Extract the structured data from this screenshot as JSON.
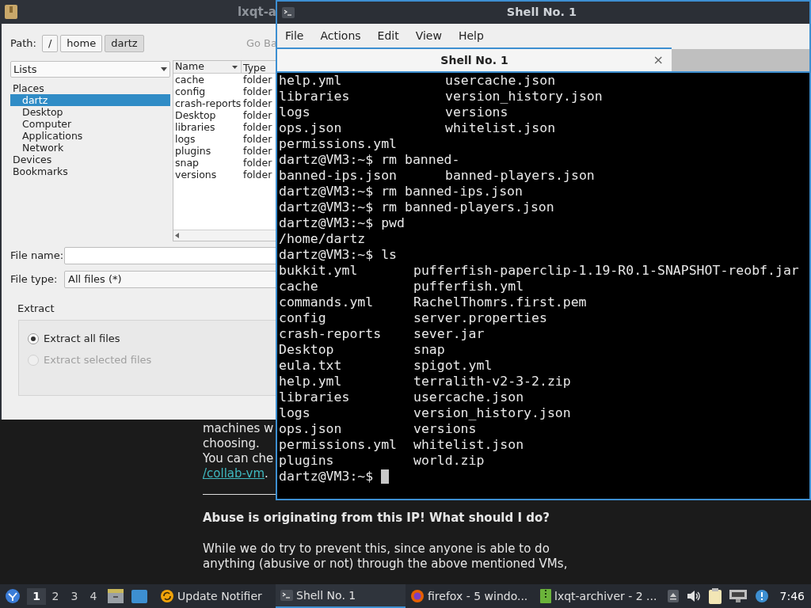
{
  "web_page": {
    "lines": [
      "machines w",
      "choosing.",
      "You can che"
    ],
    "link": "/collab-vm",
    "link_after": ".",
    "heading": "Abuse is originating from this IP! What should I do?",
    "paragraph": "While we do try to prevent this, since anyone is able to do anything (abusive or not) through the above mentioned VMs,"
  },
  "archiver": {
    "title": "lxqt-a",
    "path_label": "Path:",
    "path_buttons": [
      {
        "label": "/",
        "selected": false
      },
      {
        "label": "home",
        "selected": false
      },
      {
        "label": "dartz",
        "selected": true
      }
    ],
    "go_back": "Go Ba",
    "view_combo": "Lists",
    "places": [
      {
        "label": "Places",
        "selected": false,
        "children": [
          {
            "label": "dartz",
            "selected": true
          },
          {
            "label": "Desktop",
            "selected": false
          },
          {
            "label": "Computer",
            "selected": false
          },
          {
            "label": "Applications",
            "selected": false
          },
          {
            "label": "Network",
            "selected": false
          }
        ]
      },
      {
        "label": "Devices",
        "selected": false
      },
      {
        "label": "Bookmarks",
        "selected": false
      }
    ],
    "columns": [
      "Name",
      "Type"
    ],
    "rows": [
      [
        "cache",
        "folder"
      ],
      [
        "config",
        "folder"
      ],
      [
        "crash-reports",
        "folder"
      ],
      [
        "Desktop",
        "folder"
      ],
      [
        "libraries",
        "folder"
      ],
      [
        "logs",
        "folder"
      ],
      [
        "plugins",
        "folder"
      ],
      [
        "snap",
        "folder"
      ],
      [
        "versions",
        "folder"
      ]
    ],
    "file_name_label": "File name:",
    "file_type_label": "File type:",
    "file_type": "All files (*)",
    "extract_label": "Extract",
    "options": [
      {
        "label": "Extract all files",
        "selected": true,
        "disabled": false
      },
      {
        "label": "Extract selected files",
        "selected": false,
        "disabled": true
      }
    ]
  },
  "terminal": {
    "title": "Shell No. 1",
    "menu": [
      "File",
      "Actions",
      "Edit",
      "View",
      "Help"
    ],
    "tabs": [
      {
        "label": "Shell No. 1",
        "selected": true,
        "close": "×"
      }
    ],
    "lines": [
      {
        "kind": "wide",
        "cells": [
          "help.yml",
          "usercache.json"
        ]
      },
      {
        "kind": "wide",
        "cells": [
          "libraries",
          "version_history.json"
        ]
      },
      {
        "kind": "wide",
        "cells": [
          "logs",
          "versions"
        ]
      },
      {
        "kind": "wide",
        "cells": [
          "ops.json",
          "whitelist.json"
        ]
      },
      {
        "kind": "text",
        "cells": [
          "permissions.yml"
        ]
      },
      {
        "kind": "text",
        "cells": [
          "dartz@VM3:~$ rm banned-"
        ]
      },
      {
        "kind": "wide",
        "cells": [
          "banned-ips.json",
          "banned-players.json"
        ]
      },
      {
        "kind": "text",
        "cells": [
          "dartz@VM3:~$ rm banned-ips.json"
        ]
      },
      {
        "kind": "text",
        "cells": [
          "dartz@VM3:~$ rm banned-players.json"
        ]
      },
      {
        "kind": "text",
        "cells": [
          "dartz@VM3:~$ pwd"
        ]
      },
      {
        "kind": "text",
        "cells": [
          "/home/dartz"
        ]
      },
      {
        "kind": "text",
        "cells": [
          "dartz@VM3:~$ ls"
        ]
      },
      {
        "kind": "narrow",
        "cells": [
          "bukkit.yml",
          "pufferfish-paperclip-1.19-R0.1-SNAPSHOT-reobf.jar"
        ]
      },
      {
        "kind": "narrow",
        "cells": [
          "cache",
          "pufferfish.yml"
        ]
      },
      {
        "kind": "narrow",
        "cells": [
          "commands.yml",
          "RachelThomrs.first.pem"
        ]
      },
      {
        "kind": "narrow",
        "cells": [
          "config",
          "server.properties"
        ]
      },
      {
        "kind": "narrow",
        "cells": [
          "crash-reports",
          "sever.jar"
        ]
      },
      {
        "kind": "narrow",
        "cells": [
          "Desktop",
          "snap"
        ]
      },
      {
        "kind": "narrow",
        "cells": [
          "eula.txt",
          "spigot.yml"
        ]
      },
      {
        "kind": "narrow",
        "cells": [
          "help.yml",
          "terralith-v2-3-2.zip"
        ]
      },
      {
        "kind": "narrow",
        "cells": [
          "libraries",
          "usercache.json"
        ]
      },
      {
        "kind": "narrow",
        "cells": [
          "logs",
          "version_history.json"
        ]
      },
      {
        "kind": "narrow",
        "cells": [
          "ops.json",
          "versions"
        ]
      },
      {
        "kind": "narrow",
        "cells": [
          "permissions.yml",
          "whitelist.json"
        ]
      },
      {
        "kind": "narrow",
        "cells": [
          "plugins",
          "world.zip"
        ]
      },
      {
        "kind": "prompt",
        "cells": [
          "dartz@VM3:~$"
        ]
      }
    ]
  },
  "taskbar": {
    "desktops": [
      {
        "label": "1",
        "selected": true
      },
      {
        "label": "2",
        "selected": false
      },
      {
        "label": "3",
        "selected": false
      },
      {
        "label": "4",
        "selected": false
      }
    ],
    "tasks": [
      {
        "kind": "updater",
        "label": "Update Notifier",
        "selected": false
      },
      {
        "kind": "terminal",
        "label": "Shell No. 1",
        "selected": true
      },
      {
        "kind": "firefox",
        "label": "firefox - 5 windo...",
        "selected": false
      },
      {
        "kind": "archiver",
        "label": "lxqt-archiver - 2 ...",
        "selected": false
      }
    ],
    "clock": "7:46"
  }
}
